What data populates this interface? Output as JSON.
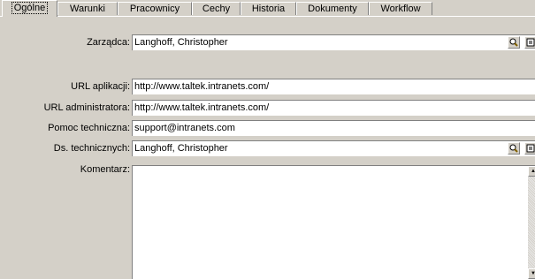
{
  "tabs": [
    {
      "label": "Ogólne",
      "active": true
    },
    {
      "label": "Warunki",
      "active": false
    },
    {
      "label": "Pracownicy",
      "active": false
    },
    {
      "label": "Cechy",
      "active": false
    },
    {
      "label": "Historia",
      "active": false
    },
    {
      "label": "Dokumenty",
      "active": false
    },
    {
      "label": "Workflow",
      "active": false
    }
  ],
  "form": {
    "manager_label": "Zarządca:",
    "manager_value": "Langhoff, Christopher",
    "app_url_label": "URL aplikacji:",
    "app_url_value": "http://www.taltek.intranets.com/",
    "admin_url_label": "URL administratora:",
    "admin_url_value": "http://www.taltek.intranets.com/",
    "support_label": "Pomoc techniczna:",
    "support_value": "support@intranets.com",
    "tech_label": "Ds. technicznych:",
    "tech_value": "Langhoff, Christopher",
    "comment_label": "Komentarz:",
    "comment_value": ""
  },
  "icons": {
    "lookup": "magnifier-icon",
    "details": "form-detail-icon",
    "scroll_up": "arrow-up-icon",
    "scroll_down": "arrow-down-icon"
  }
}
